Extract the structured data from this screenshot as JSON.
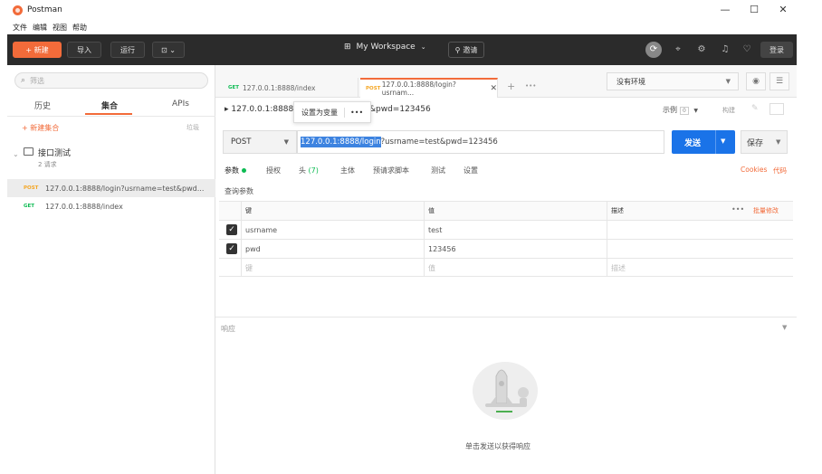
{
  "app": {
    "title": "Postman"
  },
  "window": {
    "minimize": "—",
    "maximize": "☐",
    "close": "✕"
  },
  "menu": [
    "文件",
    "编辑",
    "视图",
    "帮助"
  ],
  "toolbar": {
    "new_label": "+ 新建",
    "import_label": "导入",
    "runner_label": "运行",
    "open_new_label": "⊡ ⌄",
    "workspace_label": "My Workspace",
    "workspace_icon": "grid-icon",
    "invite_label": "邀请",
    "login_label": "登录"
  },
  "sidebar": {
    "filter_placeholder": "筛选",
    "tabs": [
      {
        "label": "历史"
      },
      {
        "label": "集合"
      },
      {
        "label": "APIs"
      }
    ],
    "active_tab": "集合",
    "new_collection_label": "+ 新建集合",
    "trash_label": "垃圾",
    "collection": {
      "name": "接口测试",
      "count": "2 请求"
    },
    "requests": [
      {
        "method": "POST",
        "url": "127.0.0.1:8888/login?usrname=test&pwd..."
      },
      {
        "method": "GET",
        "url": "127.0.0.1:8888/index"
      }
    ]
  },
  "tabs": [
    {
      "method": "GET",
      "label": "127.0.0.1:8888/index"
    },
    {
      "method": "POST",
      "label": "127.0.0.1:8888/login?usrnam..."
    }
  ],
  "env": {
    "selected": "没有环境"
  },
  "breadcrumb": {
    "prefix": "▸ 127.0.0.1:8888/l",
    "suffix": "&pwd=123456",
    "popup_set_var": "设置为变量",
    "popup_more": "•••",
    "example_label": "示例",
    "example_count": "0",
    "edit_label": "构建"
  },
  "request": {
    "method": "POST",
    "url_selected": "127.0.0.1:8888/login",
    "url_rest": "?usrname=test&pwd=123456",
    "send_label": "发送",
    "save_label": "保存"
  },
  "subtabs": {
    "params": "参数",
    "auth": "授权",
    "headers": "头",
    "headers_count": "(7)",
    "body": "主体",
    "prerequest": "预请求脚本",
    "tests": "测试",
    "settings": "设置",
    "cookies": "Cookies",
    "code": "代码"
  },
  "params": {
    "section_label": "查询参数",
    "headers": {
      "key": "键",
      "value": "值",
      "description": "描述",
      "more": "•••",
      "bulk_edit": "批量修改"
    },
    "rows": [
      {
        "key": "usrname",
        "value": "test",
        "checked": true
      },
      {
        "key": "pwd",
        "value": "123456",
        "checked": true
      }
    ],
    "placeholder": {
      "key": "键",
      "value": "值",
      "description": "描述"
    }
  },
  "response": {
    "label": "响应",
    "hint": "单击发送以获得响应"
  },
  "colors": {
    "accent": "#f26b3a",
    "send": "#1a73e8",
    "post": "#f5a623",
    "get": "#0cbb52",
    "toolbar_bg": "#2b2b2b"
  }
}
